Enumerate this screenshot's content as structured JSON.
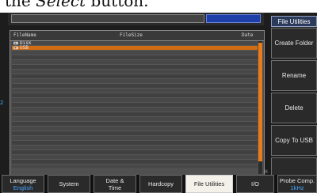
{
  "caption": {
    "prefix": "the ",
    "emphasis": "Select",
    "suffix": " button."
  },
  "file_panel": {
    "col_filename": "FileName",
    "col_filesize": "FileSize",
    "col_date": "Date",
    "items": [
      {
        "name": "Disk",
        "selected": false
      },
      {
        "name": "USB",
        "selected": true
      }
    ],
    "empty_rows": 25
  },
  "markers": {
    "left": "2",
    "right_upper": "8",
    "right_lower": "H"
  },
  "side_menu": {
    "title": "File Utilities",
    "buttons": [
      "Create Folder",
      "Rename",
      "Delete",
      "Copy To USB",
      ""
    ]
  },
  "bottom_menu": [
    {
      "label": "Language",
      "value": "English",
      "active": false
    },
    {
      "label": "System",
      "value": "",
      "active": false
    },
    {
      "label": "Date & Time",
      "value": "",
      "active": false
    },
    {
      "label": "Hardcopy",
      "value": "",
      "active": false
    },
    {
      "label": "File Utilities",
      "value": "",
      "active": true
    },
    {
      "label": "I/O",
      "value": "",
      "active": false
    },
    {
      "label": "Probe Comp.",
      "value": "1kHz",
      "active": false
    }
  ],
  "colors": {
    "selection": "#d36b12",
    "accent_blue": "#1e3ea8",
    "value_blue": "#49a6ff"
  }
}
